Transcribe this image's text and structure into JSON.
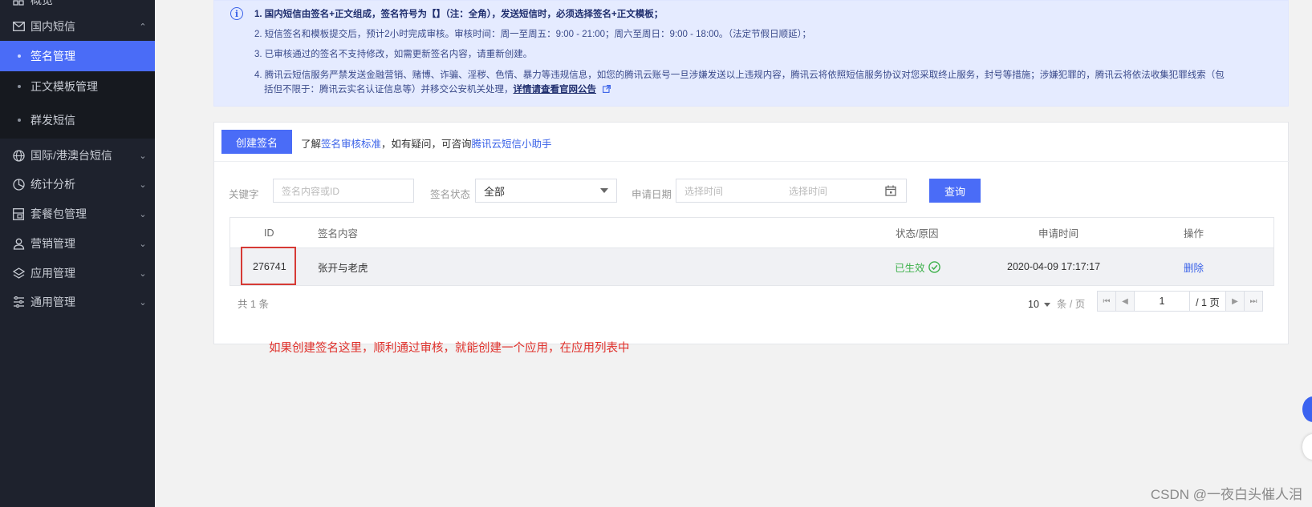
{
  "sidebar": {
    "top_partial": "概览",
    "domestic": {
      "label": "国内短信",
      "chev": "⌃"
    },
    "sub_items": [
      {
        "label": "签名管理"
      },
      {
        "label": "正文模板管理"
      },
      {
        "label": "群发短信"
      }
    ],
    "items": [
      {
        "label": "国际/港澳台短信",
        "chev": "⌄"
      },
      {
        "label": "统计分析",
        "chev": "⌄"
      },
      {
        "label": "套餐包管理",
        "chev": "⌄"
      },
      {
        "label": "营销管理",
        "chev": "⌄"
      },
      {
        "label": "应用管理",
        "chev": "⌄"
      },
      {
        "label": "通用管理",
        "chev": "⌄"
      }
    ]
  },
  "notice": {
    "line1": "1. 国内短信由签名+正文组成，签名符号为【】（注：全角），发送短信时，必须选择签名+正文模板；",
    "line2": "2. 短信签名和模板提交后，预计2小时完成审核。审核时间：周一至周五：9:00 - 21:00；周六至周日：9:00 - 18:00。（法定节假日顺延）；",
    "line3": "3. 已审核通过的签名不支持修改，如需更新签名内容，请重新创建。",
    "line4": "4. 腾讯云短信服务严禁发送金融营销、赌博、诈骗、淫秽、色情、暴力等违规信息，如您的腾讯云账号一旦涉嫌发送以上违规内容，腾讯云将依照短信服务协议对您采取终止服务，封号等措施；涉嫌犯罪的，腾讯云将依法收集犯罪线索（包",
    "line5": "括但不限于：腾讯云实名认证信息等）并移交公安机关处理，",
    "line5_link": "详情请查看官网公告"
  },
  "toolbar": {
    "create_button": "创建签名",
    "hint_prefix": "了解",
    "hint_link1": "签名审核标准",
    "hint_mid": "，如有疑问，可咨询",
    "hint_link2": "腾讯云短信小助手"
  },
  "filters": {
    "keyword_label": "关键字",
    "keyword_placeholder": "签名内容或ID",
    "status_label": "签名状态",
    "status_value": "全部",
    "date_label": "申请日期",
    "date_start_placeholder": "选择时间",
    "date_end_placeholder": "选择时间",
    "query_button": "查询"
  },
  "table": {
    "headers": {
      "id": "ID",
      "content": "签名内容",
      "status": "状态/原因",
      "time": "申请时间",
      "action": "操作"
    },
    "rows": [
      {
        "id": "276741",
        "content": "张开与老虎",
        "status": "已生效",
        "time": "2020-04-09 17:17:17",
        "action": "删除"
      }
    ]
  },
  "pagination": {
    "total_prefix": "共",
    "total": "1",
    "total_suffix": "条",
    "page_size": "10",
    "page_size_unit": "条 / 页",
    "current_page": "1",
    "total_pages": "/ 1 页"
  },
  "annotation": "如果创建签名这里，顺利通过审核，就能创建一个应用，在应用列表中",
  "watermark": "CSDN @一夜白头催人泪",
  "colors": {
    "accent": "#4a6cf7",
    "success": "#3db14b",
    "annotation_red": "#e0302b",
    "sidebar_bg": "#1e222d"
  }
}
